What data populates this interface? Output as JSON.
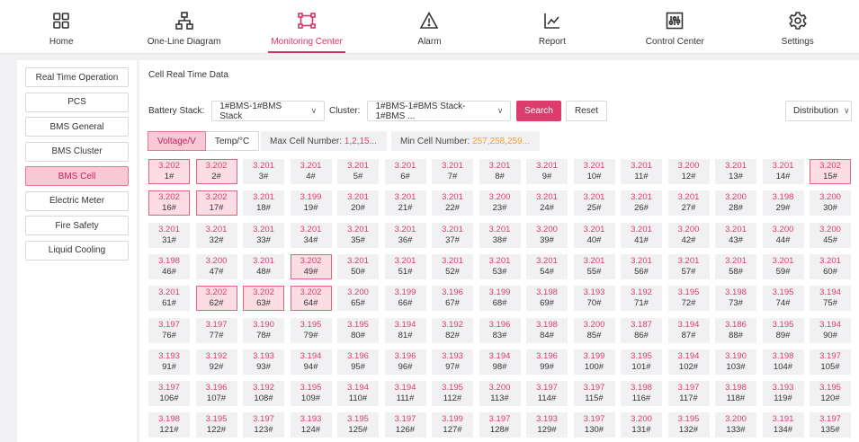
{
  "nav": [
    {
      "label": "Home",
      "icon": "home-grid-icon",
      "active": false
    },
    {
      "label": "One-Line Diagram",
      "icon": "hierarchy-icon",
      "active": false
    },
    {
      "label": "Monitoring Center",
      "icon": "monitor-frame-icon",
      "active": true
    },
    {
      "label": "Alarm",
      "icon": "warning-triangle-icon",
      "active": false
    },
    {
      "label": "Report",
      "icon": "line-chart-icon",
      "active": false
    },
    {
      "label": "Control Center",
      "icon": "sliders-icon",
      "active": false
    },
    {
      "label": "Settings",
      "icon": "gear-icon",
      "active": false
    }
  ],
  "sidebar": {
    "items": [
      {
        "label": "Real Time Operation",
        "active": false
      },
      {
        "label": "PCS",
        "active": false
      },
      {
        "label": "BMS General",
        "active": false
      },
      {
        "label": "BMS Cluster",
        "active": false
      },
      {
        "label": "BMS Cell",
        "active": true
      },
      {
        "label": "Electric Meter",
        "active": false
      },
      {
        "label": "Fire Safety",
        "active": false
      },
      {
        "label": "Liquid Cooling",
        "active": false
      }
    ]
  },
  "main": {
    "title": "Cell Real Time Data",
    "filters": {
      "battery_stack_label": "Battery Stack:",
      "battery_stack_value": "1#BMS-1#BMS Stack",
      "cluster_label": "Cluster:",
      "cluster_value": "1#BMS-1#BMS Stack-1#BMS ...",
      "search_label": "Search",
      "reset_label": "Reset",
      "distribution_label": "Distribution"
    },
    "tabs": [
      {
        "label": "Voltage/V",
        "active": true
      },
      {
        "label": "Temp/°C",
        "active": false
      }
    ],
    "max_cell_label": "Max Cell Number:",
    "max_cell_value": "1,2,15...",
    "min_cell_label": "Min Cell Number:",
    "min_cell_value": "257,258,259...",
    "colors": {
      "accent": "#dc3d6d",
      "highlight_bg": "#fcdde5",
      "min_color": "#f0a030"
    }
  },
  "cells": [
    {
      "v": "3.202",
      "n": "1#",
      "hi": true
    },
    {
      "v": "3.202",
      "n": "2#",
      "hi": true
    },
    {
      "v": "3.201",
      "n": "3#"
    },
    {
      "v": "3.201",
      "n": "4#"
    },
    {
      "v": "3.201",
      "n": "5#"
    },
    {
      "v": "3.201",
      "n": "6#"
    },
    {
      "v": "3.201",
      "n": "7#"
    },
    {
      "v": "3.201",
      "n": "8#"
    },
    {
      "v": "3.201",
      "n": "9#"
    },
    {
      "v": "3.201",
      "n": "10#"
    },
    {
      "v": "3.201",
      "n": "11#"
    },
    {
      "v": "3.200",
      "n": "12#"
    },
    {
      "v": "3.201",
      "n": "13#"
    },
    {
      "v": "3.201",
      "n": "14#"
    },
    {
      "v": "3.202",
      "n": "15#",
      "hi": true
    },
    {
      "v": "3.202",
      "n": "16#",
      "hi": true
    },
    {
      "v": "3.202",
      "n": "17#",
      "hi": true
    },
    {
      "v": "3.201",
      "n": "18#"
    },
    {
      "v": "3.199",
      "n": "19#"
    },
    {
      "v": "3.201",
      "n": "20#"
    },
    {
      "v": "3.201",
      "n": "21#"
    },
    {
      "v": "3.201",
      "n": "22#"
    },
    {
      "v": "3.200",
      "n": "23#"
    },
    {
      "v": "3.201",
      "n": "24#"
    },
    {
      "v": "3.201",
      "n": "25#"
    },
    {
      "v": "3.201",
      "n": "26#"
    },
    {
      "v": "3.201",
      "n": "27#"
    },
    {
      "v": "3.200",
      "n": "28#"
    },
    {
      "v": "3.198",
      "n": "29#"
    },
    {
      "v": "3.200",
      "n": "30#"
    },
    {
      "v": "3.201",
      "n": "31#"
    },
    {
      "v": "3.201",
      "n": "32#"
    },
    {
      "v": "3.201",
      "n": "33#"
    },
    {
      "v": "3.201",
      "n": "34#"
    },
    {
      "v": "3.201",
      "n": "35#"
    },
    {
      "v": "3.201",
      "n": "36#"
    },
    {
      "v": "3.201",
      "n": "37#"
    },
    {
      "v": "3.201",
      "n": "38#"
    },
    {
      "v": "3.200",
      "n": "39#"
    },
    {
      "v": "3.201",
      "n": "40#"
    },
    {
      "v": "3.201",
      "n": "41#"
    },
    {
      "v": "3.200",
      "n": "42#"
    },
    {
      "v": "3.201",
      "n": "43#"
    },
    {
      "v": "3.200",
      "n": "44#"
    },
    {
      "v": "3.200",
      "n": "45#"
    },
    {
      "v": "3.198",
      "n": "46#"
    },
    {
      "v": "3.200",
      "n": "47#"
    },
    {
      "v": "3.201",
      "n": "48#"
    },
    {
      "v": "3.202",
      "n": "49#",
      "hi": true
    },
    {
      "v": "3.201",
      "n": "50#"
    },
    {
      "v": "3.201",
      "n": "51#"
    },
    {
      "v": "3.201",
      "n": "52#"
    },
    {
      "v": "3.201",
      "n": "53#"
    },
    {
      "v": "3.201",
      "n": "54#"
    },
    {
      "v": "3.201",
      "n": "55#"
    },
    {
      "v": "3.201",
      "n": "56#"
    },
    {
      "v": "3.201",
      "n": "57#"
    },
    {
      "v": "3.201",
      "n": "58#"
    },
    {
      "v": "3.201",
      "n": "59#"
    },
    {
      "v": "3.201",
      "n": "60#"
    },
    {
      "v": "3.201",
      "n": "61#"
    },
    {
      "v": "3.202",
      "n": "62#",
      "hi": true
    },
    {
      "v": "3.202",
      "n": "63#",
      "hi": true
    },
    {
      "v": "3.202",
      "n": "64#",
      "hi": true
    },
    {
      "v": "3.200",
      "n": "65#"
    },
    {
      "v": "3.199",
      "n": "66#"
    },
    {
      "v": "3.196",
      "n": "67#"
    },
    {
      "v": "3.199",
      "n": "68#"
    },
    {
      "v": "3.198",
      "n": "69#"
    },
    {
      "v": "3.193",
      "n": "70#"
    },
    {
      "v": "3.192",
      "n": "71#"
    },
    {
      "v": "3.195",
      "n": "72#"
    },
    {
      "v": "3.198",
      "n": "73#"
    },
    {
      "v": "3.195",
      "n": "74#"
    },
    {
      "v": "3.194",
      "n": "75#"
    },
    {
      "v": "3.197",
      "n": "76#"
    },
    {
      "v": "3.197",
      "n": "77#"
    },
    {
      "v": "3.190",
      "n": "78#"
    },
    {
      "v": "3.195",
      "n": "79#"
    },
    {
      "v": "3.195",
      "n": "80#"
    },
    {
      "v": "3.194",
      "n": "81#"
    },
    {
      "v": "3.192",
      "n": "82#"
    },
    {
      "v": "3.196",
      "n": "83#"
    },
    {
      "v": "3.198",
      "n": "84#"
    },
    {
      "v": "3.200",
      "n": "85#"
    },
    {
      "v": "3.187",
      "n": "86#"
    },
    {
      "v": "3.194",
      "n": "87#"
    },
    {
      "v": "3.186",
      "n": "88#"
    },
    {
      "v": "3.195",
      "n": "89#"
    },
    {
      "v": "3.194",
      "n": "90#"
    },
    {
      "v": "3.193",
      "n": "91#"
    },
    {
      "v": "3.192",
      "n": "92#"
    },
    {
      "v": "3.193",
      "n": "93#"
    },
    {
      "v": "3.194",
      "n": "94#"
    },
    {
      "v": "3.196",
      "n": "95#"
    },
    {
      "v": "3.196",
      "n": "96#"
    },
    {
      "v": "3.193",
      "n": "97#"
    },
    {
      "v": "3.194",
      "n": "98#"
    },
    {
      "v": "3.196",
      "n": "99#"
    },
    {
      "v": "3.199",
      "n": "100#"
    },
    {
      "v": "3.195",
      "n": "101#"
    },
    {
      "v": "3.194",
      "n": "102#"
    },
    {
      "v": "3.190",
      "n": "103#"
    },
    {
      "v": "3.198",
      "n": "104#"
    },
    {
      "v": "3.197",
      "n": "105#"
    },
    {
      "v": "3.197",
      "n": "106#"
    },
    {
      "v": "3.196",
      "n": "107#"
    },
    {
      "v": "3.192",
      "n": "108#"
    },
    {
      "v": "3.195",
      "n": "109#"
    },
    {
      "v": "3.194",
      "n": "110#"
    },
    {
      "v": "3.194",
      "n": "111#"
    },
    {
      "v": "3.195",
      "n": "112#"
    },
    {
      "v": "3.200",
      "n": "113#"
    },
    {
      "v": "3.197",
      "n": "114#"
    },
    {
      "v": "3.197",
      "n": "115#"
    },
    {
      "v": "3.198",
      "n": "116#"
    },
    {
      "v": "3.197",
      "n": "117#"
    },
    {
      "v": "3.198",
      "n": "118#"
    },
    {
      "v": "3.193",
      "n": "119#"
    },
    {
      "v": "3.195",
      "n": "120#"
    },
    {
      "v": "3.198",
      "n": "121#"
    },
    {
      "v": "3.195",
      "n": "122#"
    },
    {
      "v": "3.197",
      "n": "123#"
    },
    {
      "v": "3.193",
      "n": "124#"
    },
    {
      "v": "3.195",
      "n": "125#"
    },
    {
      "v": "3.197",
      "n": "126#"
    },
    {
      "v": "3.199",
      "n": "127#"
    },
    {
      "v": "3.197",
      "n": "128#"
    },
    {
      "v": "3.193",
      "n": "129#"
    },
    {
      "v": "3.197",
      "n": "130#"
    },
    {
      "v": "3.200",
      "n": "131#"
    },
    {
      "v": "3.195",
      "n": "132#"
    },
    {
      "v": "3.200",
      "n": "133#"
    },
    {
      "v": "3.191",
      "n": "134#"
    },
    {
      "v": "3.197",
      "n": "135#"
    }
  ]
}
